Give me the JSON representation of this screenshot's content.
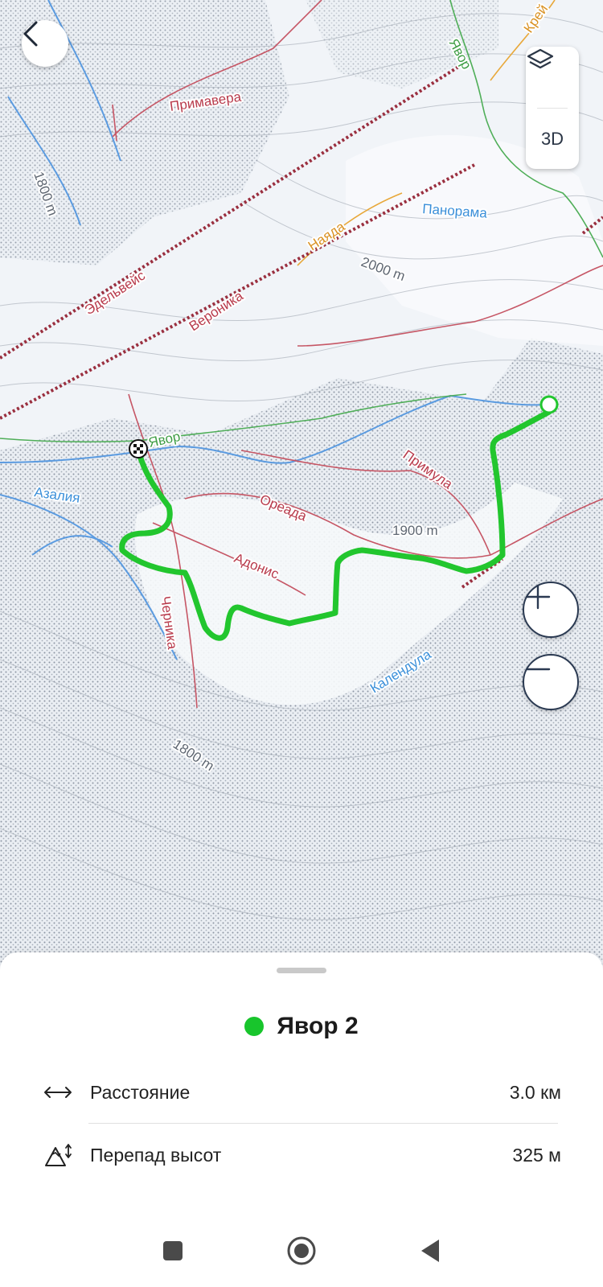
{
  "map": {
    "pistes": [
      {
        "name": "Примавера",
        "color": "#b83a4b"
      },
      {
        "name": "Эдельвейс",
        "color": "#b83a4b"
      },
      {
        "name": "Вероника",
        "color": "#b83a4b"
      },
      {
        "name": "Наяда",
        "color": "#e3a233"
      },
      {
        "name": "Панорама",
        "color": "#3a8fd9"
      },
      {
        "name": "Явор",
        "color": "#3f9d45"
      },
      {
        "name": "Крей",
        "color": "#e3a233"
      },
      {
        "name": "Азалия",
        "color": "#3a8fd9"
      },
      {
        "name": "Ореада",
        "color": "#b83a4b"
      },
      {
        "name": "Примула",
        "color": "#b83a4b"
      },
      {
        "name": "Адонис",
        "color": "#b83a4b"
      },
      {
        "name": "Черника",
        "color": "#b83a4b"
      },
      {
        "name": "Календула",
        "color": "#3a8fd9"
      },
      {
        "name": "Явор",
        "color": "#3f9d45"
      }
    ],
    "contour_labels": [
      "1800 m",
      "2000 m",
      "1900 m",
      "1800 m"
    ],
    "route_color": "#22c62e"
  },
  "controls": {
    "back_icon": "chevron-left-icon",
    "layers_icon": "layers-icon",
    "btn_3d_label": "3D",
    "zoom_in_icon": "plus-icon",
    "zoom_out_icon": "minus-icon"
  },
  "sheet": {
    "route_name": "Явор 2",
    "route_dot_color": "#18c52c",
    "rows": [
      {
        "icon": "distance-arrows-icon",
        "label": "Расстояние",
        "value": "3.0 км"
      },
      {
        "icon": "elevation-icon",
        "label": "Перепад высот",
        "value": "325 м"
      }
    ]
  },
  "navbar": {
    "items": [
      "recent-apps-icon",
      "home-icon",
      "back-triangle-icon"
    ]
  }
}
